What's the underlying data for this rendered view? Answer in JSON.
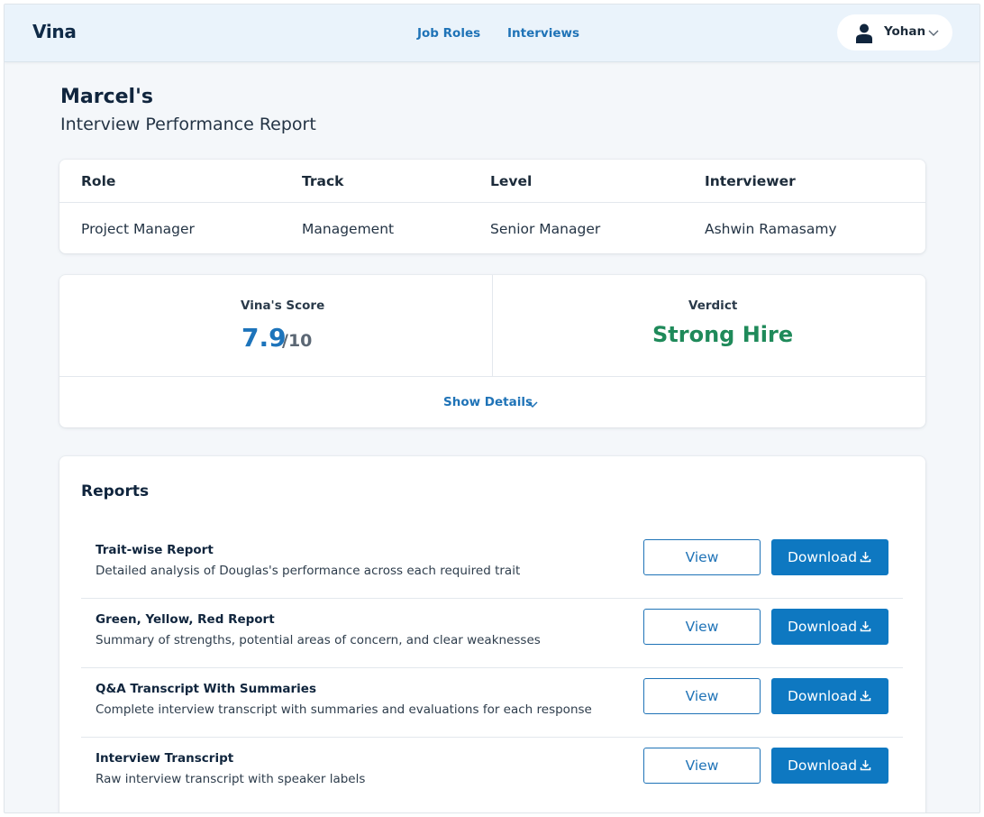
{
  "app": {
    "logo": "Vina"
  },
  "nav": {
    "links": [
      "Job Roles",
      "Interviews"
    ],
    "user": {
      "name": "Yohan",
      "icon": "user-icon",
      "dropdown_icon": "chevron-down-icon"
    }
  },
  "page": {
    "title": "Marcel's",
    "subtitle": "Interview Performance Report"
  },
  "info": {
    "headers": [
      "Role",
      "Track",
      "Level",
      "Interviewer"
    ],
    "values": [
      "Project Manager",
      "Management",
      "Senior Manager",
      "Ashwin Ramasamy"
    ]
  },
  "score": {
    "label": "Vina's Score",
    "value": "7.9",
    "max": "/10",
    "verdict_label": "Verdict",
    "verdict": "Strong Hire",
    "verdict_color": "#1f8a5a",
    "details_toggle": "Show Details"
  },
  "reports": {
    "title": "Reports",
    "view_label": "View",
    "download_label": "Download",
    "items": [
      {
        "name": "Trait-wise Report",
        "desc": "Detailed analysis of Douglas's performance across each required trait"
      },
      {
        "name": "Green, Yellow, Red Report",
        "desc": "Summary of strengths, potential areas of concern, and clear weaknesses"
      },
      {
        "name": "Q&A Transcript With Summaries",
        "desc": "Complete interview transcript with summaries and evaluations for each response"
      },
      {
        "name": "Interview Transcript",
        "desc": "Raw interview transcript with speaker labels"
      }
    ]
  },
  "colors": {
    "accent": "#1f73b7",
    "primary_button": "#0e78c1",
    "navbar_bg": "#eaf3fb"
  }
}
